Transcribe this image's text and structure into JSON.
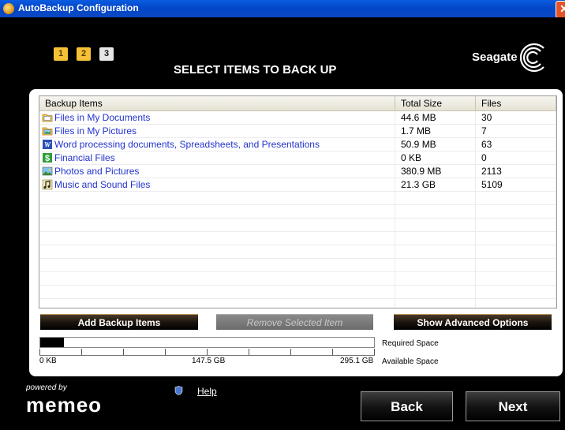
{
  "window": {
    "title": "AutoBackup Configuration"
  },
  "steps": [
    "1",
    "2",
    "3"
  ],
  "heading": "SELECT ITEMS TO BACK UP",
  "brand": "Seagate",
  "table": {
    "headers": [
      "Backup Items",
      "Total Size",
      "Files"
    ],
    "rows": [
      {
        "name": "Files in My Documents",
        "size": "44.6 MB",
        "files": "30",
        "icon": "folder-documents-icon"
      },
      {
        "name": "Files in My Pictures",
        "size": "1.7 MB",
        "files": "7",
        "icon": "folder-pictures-icon"
      },
      {
        "name": "Word processing documents, Spreadsheets, and Presentations",
        "size": "50.9 MB",
        "files": "63",
        "icon": "word-document-icon"
      },
      {
        "name": "Financial Files",
        "size": "0 KB",
        "files": "0",
        "icon": "dollar-icon"
      },
      {
        "name": "Photos and Pictures",
        "size": "380.9 MB",
        "files": "2113",
        "icon": "photo-icon"
      },
      {
        "name": "Music and Sound Files",
        "size": "21.3 GB",
        "files": "5109",
        "icon": "music-note-icon"
      }
    ]
  },
  "buttons": {
    "add": "Add Backup Items",
    "remove": "Remove Selected Item",
    "advanced": "Show Advanced Options",
    "back": "Back",
    "next": "Next"
  },
  "space": {
    "required_label": "Required Space",
    "available_label": "Available Space",
    "scale": [
      "0 KB",
      "147.5 GB",
      "295.1 GB"
    ],
    "used_fraction": 0.072
  },
  "footer": {
    "powered": "powered by",
    "logo": "memeo",
    "help": "Help"
  },
  "colors": {
    "title_bar": "#0347c8",
    "step_done": "#f4c137",
    "link_blue": "#2233cc",
    "background": "#000000"
  }
}
